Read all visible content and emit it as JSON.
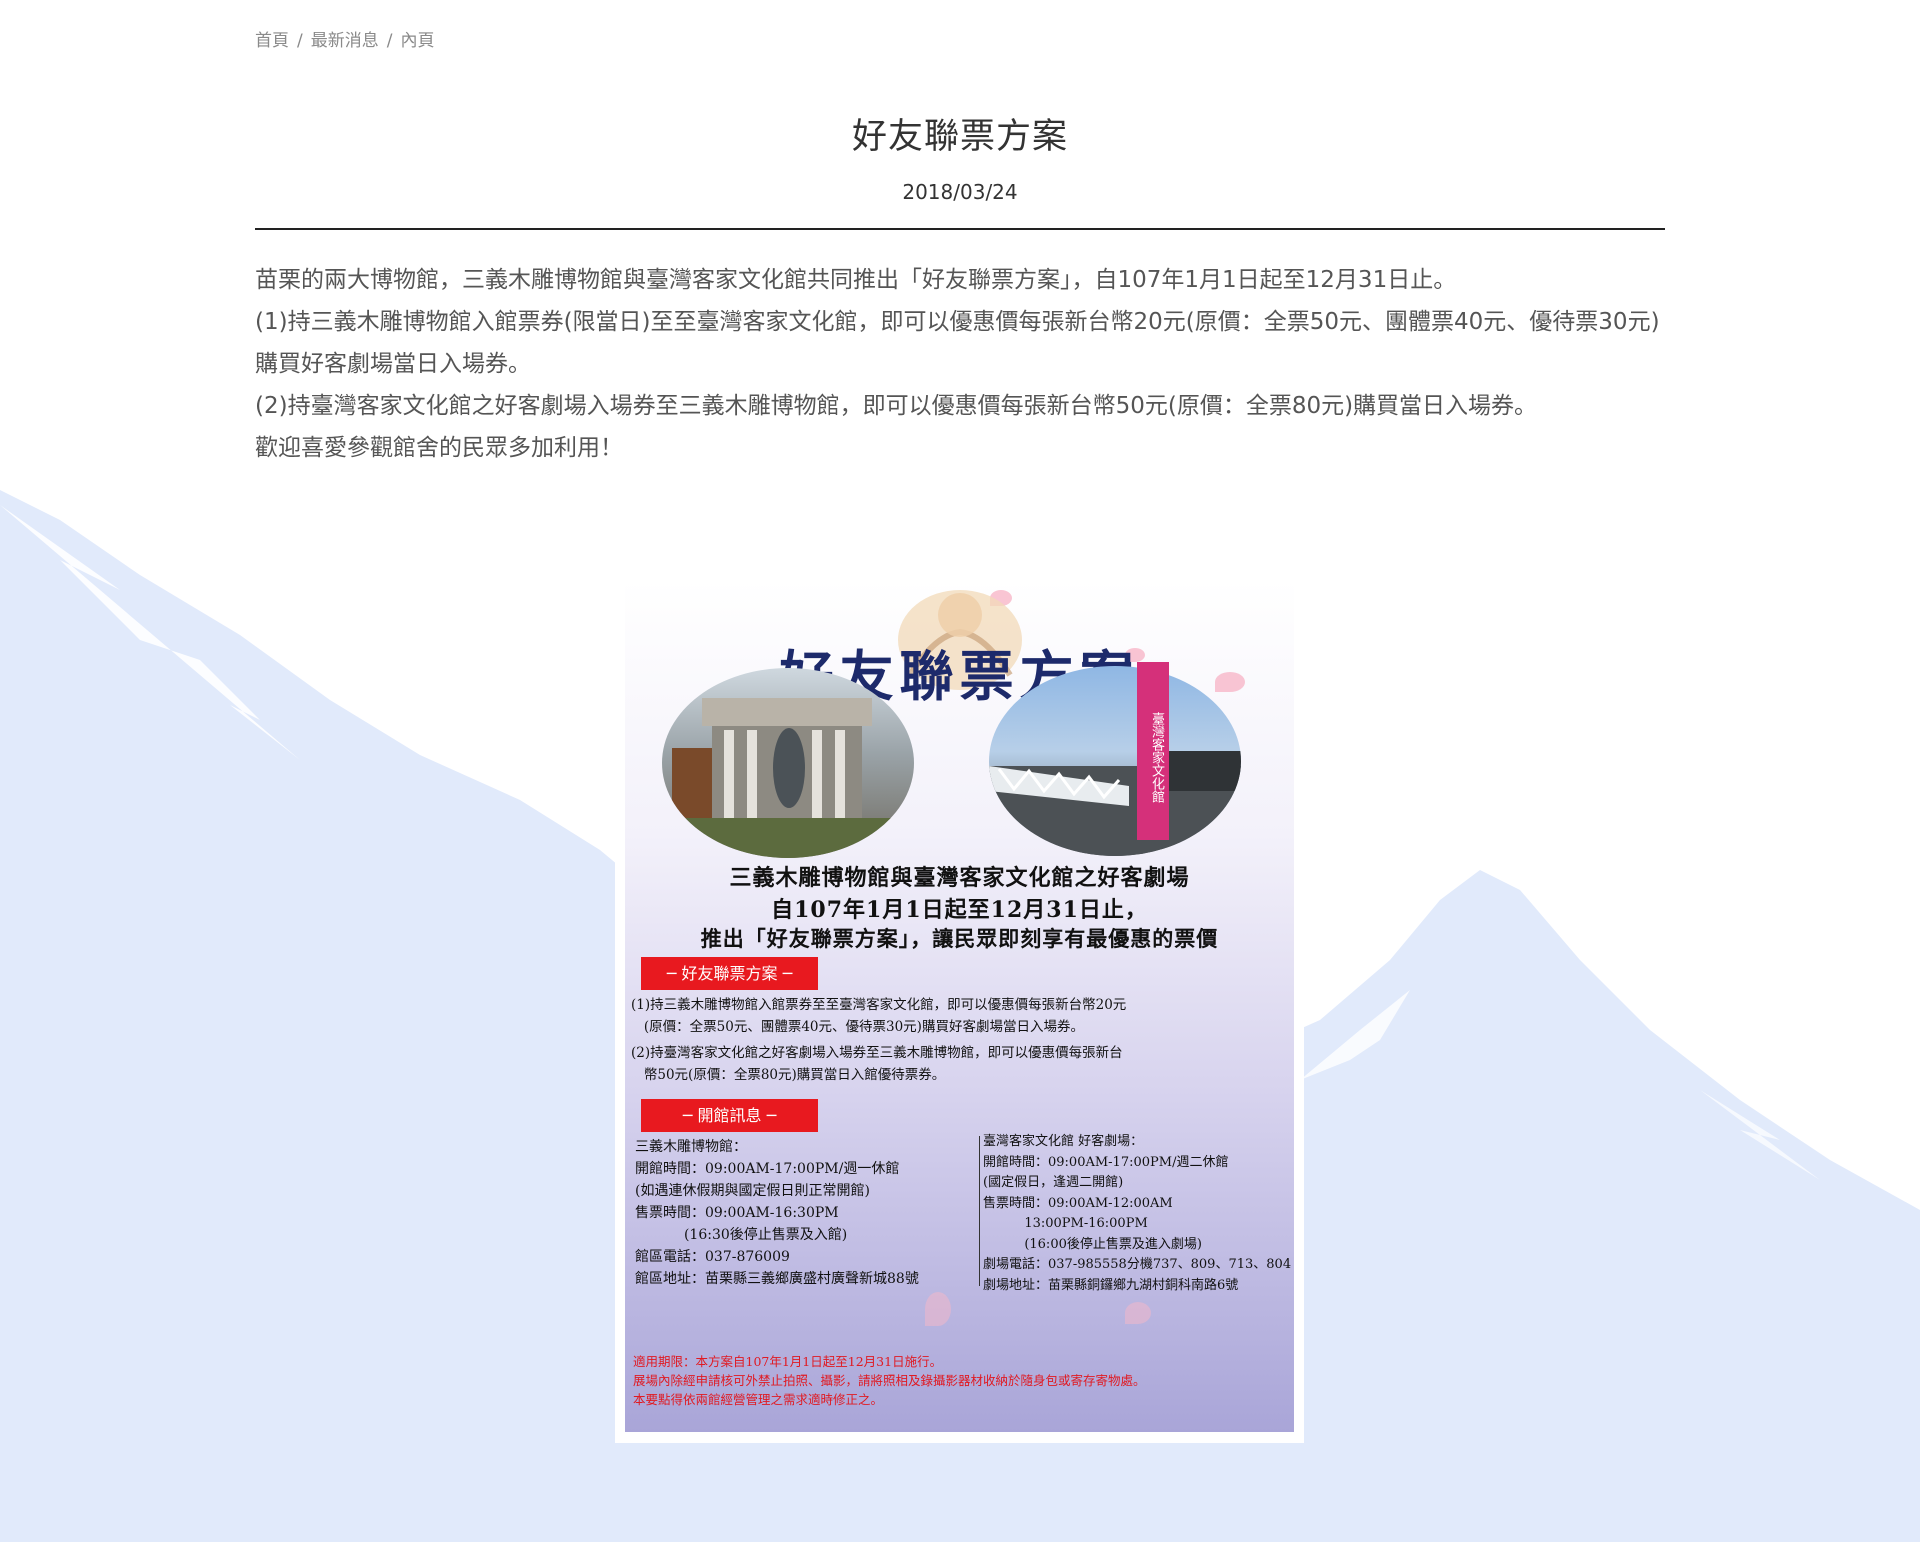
{
  "breadcrumb": {
    "items": [
      "首頁",
      "最新消息",
      "內頁"
    ],
    "separator": "/"
  },
  "article": {
    "title": "好友聯票方案",
    "date": "2018/03/24",
    "paragraphs": [
      "苗栗的兩大博物館，三義木雕博物館與臺灣客家文化館共同推出「好友聯票方案」，自107年1月1日起至12月31日止。",
      "(1)持三義木雕博物館入館票券(限當日)至至臺灣客家文化館，即可以優惠價每張新台幣20元(原價：全票50元、團體票40元、優待票30元)購買好客劇場當日入場券。",
      "(2)持臺灣客家文化館之好客劇場入場券至三義木雕博物館，即可以優惠價每張新台幣50元(原價：全票80元)購買當日入場券。",
      "歡迎喜愛參觀館舍的民眾多加利用！"
    ]
  },
  "poster": {
    "title": "好友聯票方案",
    "tower_text": "臺灣客家文化館",
    "headline_1": "三義木雕博物館與臺灣客家文化館之好客劇場",
    "headline_2": "自107年1月1日起至12月31日止，",
    "headline_3": "推出「好友聯票方案」，讓民眾即刻享有最優惠的票價",
    "tag_plan": "─ 好友聯票方案 ─",
    "plan_1": "(1)持三義木雕博物館入館票券至至臺灣客家文化館，即可以優惠價每張新台幣20元\n   (原價：全票50元、團體票40元、優待票30元)購買好客劇場當日入場券。",
    "plan_2": "(2)持臺灣客家文化館之好客劇場入場券至三義木雕博物館，即可以優惠價每張新台\n   幣50元(原價：全票80元)購買當日入館優待票券。",
    "tag_info": "─  開館訊息  ─",
    "info_left": "三義木雕博物館：\n開館時間：09:00AM-17:00PM/週一休館\n(如遇連休假期與國定假日則正常開館)\n售票時間：09:00AM-16:30PM\n           (16:30後停止售票及入館)\n館區電話：037-876009\n館區地址：苗栗縣三義鄉廣盛村廣聲新城88號",
    "info_right": "臺灣客家文化館 好客劇場：\n開館時間：09:00AM-17:00PM/週二休館\n(國定假日，逢週二開館)\n售票時間：09:00AM-12:00AM\n          13:00PM-16:00PM\n          (16:00後停止售票及進入劇場)\n劇場電話：037-985558分機737、809、713、804\n劇場地址：苗栗縣銅鑼鄉九湖村銅科南路6號",
    "notes": "適用期限：本方案自107年1月1日起至12月31日施行。\n展場內除經申請核可外禁止拍照、攝影，請將照相及錄攝影器材收納於隨身包或寄存寄物處。\n本要點得依兩館經營管理之需求適時修正之。"
  },
  "colors": {
    "background_mountain": "#e1eafb",
    "divider": "#222222",
    "poster_title": "#1d2a6b",
    "poster_tag": "#e8191f"
  }
}
